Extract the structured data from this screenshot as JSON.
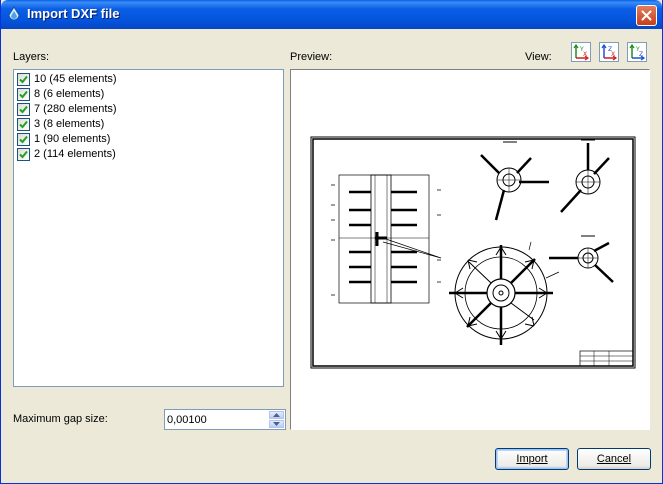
{
  "window": {
    "title": "Import DXF file"
  },
  "layers": {
    "label": "Layers:",
    "items": [
      {
        "label": "10 (45 elements)",
        "checked": true
      },
      {
        "label": "8 (6 elements)",
        "checked": true
      },
      {
        "label": "7 (280 elements)",
        "checked": true
      },
      {
        "label": "3 (8 elements)",
        "checked": true
      },
      {
        "label": "1 (90 elements)",
        "checked": true
      },
      {
        "label": "2 (114 elements)",
        "checked": true
      }
    ]
  },
  "preview": {
    "label": "Preview:",
    "view_label": "View:",
    "view_buttons": [
      "view-xy-icon",
      "view-xz-icon",
      "view-yz-icon"
    ]
  },
  "gap": {
    "label": "Maximum gap size:",
    "value": "0,00100"
  },
  "buttons": {
    "import": "Import",
    "cancel": "Cancel"
  }
}
